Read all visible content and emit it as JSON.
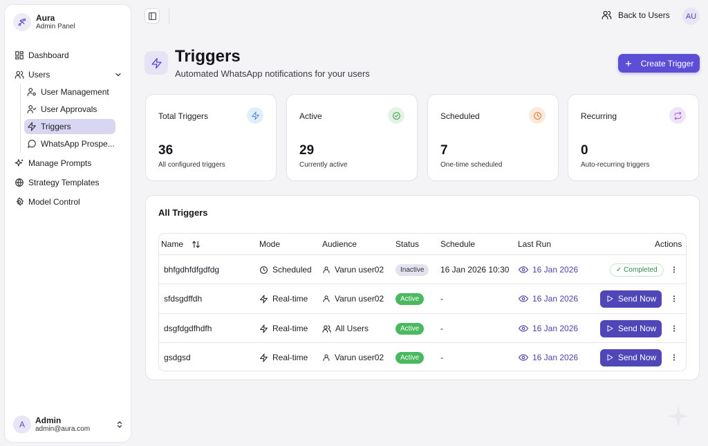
{
  "brand": {
    "name": "Aura",
    "subtitle": "Admin Panel",
    "logo_icon": "sparkle-nodes-icon"
  },
  "sidebar": {
    "items": [
      {
        "label": "Dashboard",
        "icon": "grid-icon"
      },
      {
        "label": "Users",
        "icon": "users-icon",
        "expanded": true
      },
      {
        "label": "User Management",
        "icon": "user-cog-icon"
      },
      {
        "label": "User Approvals",
        "icon": "user-check-icon"
      },
      {
        "label": "Triggers",
        "icon": "zap-icon",
        "active": true
      },
      {
        "label": "WhatsApp Prospe...",
        "icon": "message-circle-icon"
      },
      {
        "label": "Manage Prompts",
        "icon": "sparkles-icon"
      },
      {
        "label": "Strategy Templates",
        "icon": "globe-icon"
      },
      {
        "label": "Model Control",
        "icon": "settings-icon"
      }
    ],
    "user": {
      "initial": "A",
      "name": "Admin",
      "email": "admin@aura.com"
    }
  },
  "topbar": {
    "back_label": "Back to Users",
    "avatar_initials": "AU"
  },
  "page": {
    "title": "Triggers",
    "subtitle": "Automated WhatsApp notifications for your users",
    "create_label": "Create Trigger"
  },
  "stats": [
    {
      "title": "Total Triggers",
      "value": "36",
      "desc": "All configured triggers",
      "icon": "zap-icon",
      "color": "#4a8fe0",
      "bg": "#e3eefb"
    },
    {
      "title": "Active",
      "value": "29",
      "desc": "Currently active",
      "icon": "check-circle-icon",
      "color": "#3aa652",
      "bg": "#e3f4e6"
    },
    {
      "title": "Scheduled",
      "value": "7",
      "desc": "One-time scheduled",
      "icon": "clock-icon",
      "color": "#e07b2e",
      "bg": "#fbe9db"
    },
    {
      "title": "Recurring",
      "value": "0",
      "desc": "Auto-recurring triggers",
      "icon": "repeat-icon",
      "color": "#9b5fd6",
      "bg": "#efe4fa"
    }
  ],
  "table": {
    "title": "All Triggers",
    "headers": {
      "name": "Name",
      "mode": "Mode",
      "audience": "Audience",
      "status": "Status",
      "schedule": "Schedule",
      "last_run": "Last Run",
      "actions": "Actions"
    },
    "rows": [
      {
        "name": "bhfgdhfdfgdfdg",
        "mode": "Scheduled",
        "mode_icon": "clock-icon",
        "audience": "Varun user02",
        "audience_icon": "user-icon",
        "status": "Inactive",
        "schedule": "16 Jan 2026 10:30",
        "last_run": "16 Jan 2026",
        "action": "✓ Completed",
        "action_type": "completed"
      },
      {
        "name": "sfdsgdffdh",
        "mode": "Real-time",
        "mode_icon": "zap-icon",
        "audience": "Varun user02",
        "audience_icon": "user-icon",
        "status": "Active",
        "schedule": "-",
        "last_run": "16 Jan 2026",
        "action": "Send Now",
        "action_type": "send"
      },
      {
        "name": "dsgfdgdfhdfh",
        "mode": "Real-time",
        "mode_icon": "zap-icon",
        "audience": "All Users",
        "audience_icon": "users-icon",
        "status": "Active",
        "schedule": "-",
        "last_run": "16 Jan 2026",
        "action": "Send Now",
        "action_type": "send"
      },
      {
        "name": "gsdgsd",
        "mode": "Real-time",
        "mode_icon": "zap-icon",
        "audience": "Varun user02",
        "audience_icon": "user-icon",
        "status": "Active",
        "schedule": "-",
        "last_run": "16 Jan 2026",
        "action": "Send Now",
        "action_type": "send"
      }
    ]
  }
}
